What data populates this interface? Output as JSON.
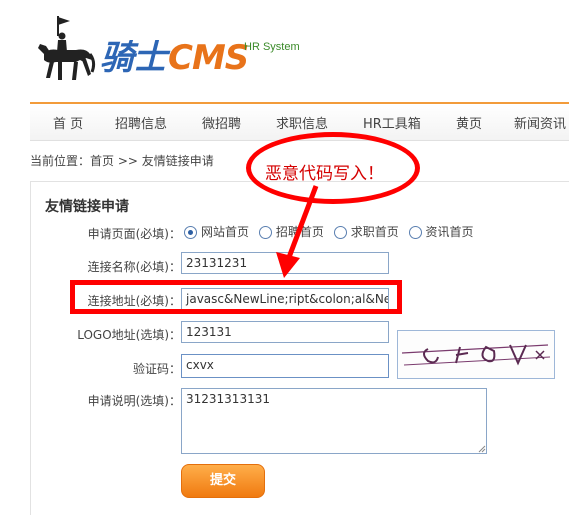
{
  "header": {
    "brand_main": "骑士",
    "brand_cms": "CMS",
    "brand_tagline": "HR System"
  },
  "nav": {
    "items": [
      "首 页",
      "招聘信息",
      "微招聘",
      "求职信息",
      "HR工具箱",
      "黄页",
      "新闻资讯"
    ]
  },
  "breadcrumb": "当前位置：首页 >> 友情链接申请",
  "panel": {
    "title": "友情链接申请"
  },
  "form": {
    "apply_page_label": "申请页面(必填)：",
    "apply_page_options": [
      "网站首页",
      "招聘首页",
      "求职首页",
      "资讯首页"
    ],
    "apply_page_selected": "网站首页",
    "link_name_label": "连接名称(必填)：",
    "link_name_value": "23131231",
    "link_url_label": "连接地址(必填)：",
    "link_url_value": "javasc&NewLine;ript&colon;al&NewL",
    "logo_label": "LOGO地址(选填)：",
    "logo_value": "123131",
    "captcha_label": "验证码：",
    "captcha_value": "cxvx",
    "desc_label": "申请说明(选填)：",
    "desc_value": "31231313131",
    "submit_label": "提交"
  },
  "annotation": {
    "text": "恶意代码写入！",
    "color": "#ff0000"
  },
  "colors": {
    "brand_blue": "#2d66b5",
    "brand_orange": "#e8731a",
    "nav_accent": "#f29b3a",
    "submit_orange": "#f07a10"
  }
}
